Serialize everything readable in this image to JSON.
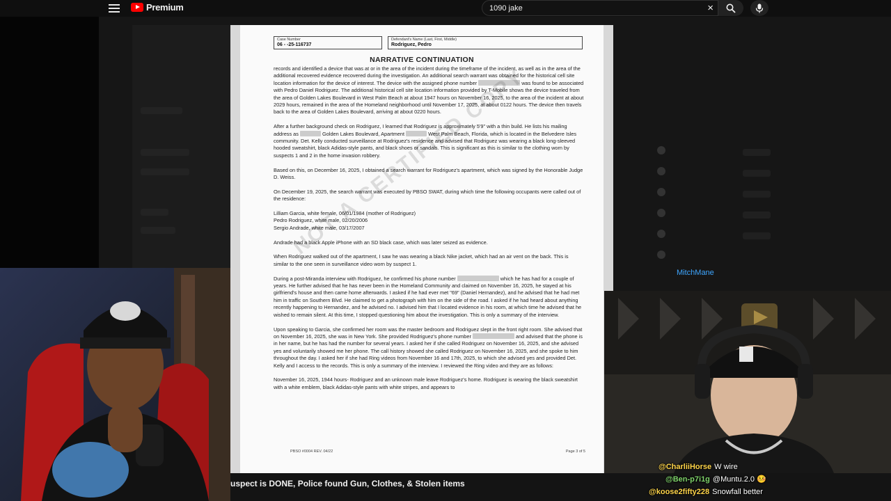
{
  "topbar": {
    "brand": "Premium",
    "search_value": "1090 jake",
    "clear_glyph": "×"
  },
  "document": {
    "case_number_label": "Case Number",
    "case_number": "06 - -25-116737",
    "defendant_label": "Defendant's Name (Last, First, Middle)",
    "defendant_name": "Rodriguez, Pedro",
    "title": "NARRATIVE CONTINUATION",
    "p1a": "records and identified a device that was at or in the area of the incident during the timeframe of the incident, as well as in the area of the additional recovered evidence recovered during the investigation. An additional search warrant was obtained for the historical cell site location information for the device of interest. The device with the assigned phone number",
    "p1b": "was found to be associated with Pedro Daniel Rodriguez. The additional historical cell site location information provided by T-Mobile shows the device traveled from the area of Golden Lakes Boulevard in West Palm Beach at about 1947 hours on November 16, 2025, to the area of the incident at about 2029 hours, remained in the area of the Homeland neighborhood until November 17, 2025, at about 0122 hours. The device then travels back to the area of Golden Lakes Boulevard, arriving at about 0220 hours.",
    "p2a": "After a further background check on Rodriguez, I learned that Rodriguez is approximately 5'9\" with a thin build. He lists his mailing address as",
    "p2b": "Golden Lakes Boulevard, Apartment",
    "p2c": "West Palm Beach, Florida, which is located in the Belvedere Isles community. Det. Kelly conducted surveillance at Rodriguez's residence and advised that Rodriguez was wearing a black long-sleeved hooded sweatshirt, black Adidas-style pants, and black shoes or sandals. This is significant as this is similar to the clothing worn by suspects 1 and 2 in the home invasion robbery.",
    "p3": "Based on this, on December 16, 2025, I obtained a search warrant for Rodriguez's apartment, which was signed by the Honorable Judge D. Weiss.",
    "p4": "On December 19, 2025, the search warrant was executed by PBSO SWAT, during which time the following occupants were called out of the residence:",
    "occ1": "Lilliam Garcia, white female, 06/01/1984 (mother of Rodriguez)",
    "occ2": "Pedro Rodriguez, white male, 02/20/2006",
    "occ3": "Sergio Andrade, white male, 03/17/2007",
    "p5": "Andrade had a black Apple iPhone with an SD black case, which was later seized as evidence.",
    "p6": "When Rodriguez walked out of the apartment, I saw he was wearing a black Nike jacket, which had an air vent on the back. This is similar to the one seen in surveillance video worn by suspect 1.",
    "p7a": "During a post-Miranda interview with Rodriguez, he confirmed his phone number",
    "p7b": "which he has had for a couple of years. He further advised that he has never been in the Homeland Community and claimed on November 16, 2025, he stayed at his girlfriend's house and then came home afterwards. I asked if he had ever met \"69\" (Daniel Hernandez), and he advised that he had met him in traffic on Southern Blvd. He claimed to get a photograph with him on the side of the road. I asked if he had heard about anything recently happening to Hernandez, and he advised no. I advised him that I located evidence in his room, at which time he advised that he wished to remain silent. At this time, I stopped questioning him about the investigation. This is only a summary of the interview.",
    "p8a": "Upon speaking to Garcia, she confirmed her room was the master bedroom and Rodriguez slept in the front right room. She advised that on November 16, 2025, she was in New York. She provided Rodriguez's phone number",
    "p8b": "and advised that the phone is in her name, but he has had the number for several years. I asked her if she called Rodriguez on November 16, 2025, and she advised yes and voluntarily showed me her phone. The call history showed she called Rodriguez on November 16, 2025, and she spoke to him throughout the day. I asked her if she had Ring videos from November 16 and 17th, 2025, to which she advised yes and provided Det. Kelly and I access to the records. This is only a summary of the interview. I reviewed the Ring video and they are as follows:",
    "p9": "November 16, 2025, 1944 hours- Rodriguez and an unknown male leave Rodriguez's home. Rodriguez is wearing the black sweatshirt with a white emblem, black Adidas-style pants with white stripes, and appears to",
    "watermark": "NOT A CERTIFIED COPY",
    "footer_left": "PBSO #0004 REV. 04/22",
    "footer_right": "Page 3 of 5"
  },
  "video": {
    "title": "uspect is DONE, Police found Gun, Clothes, & Stolen items"
  },
  "chat": {
    "pinned_user": "MitchMane",
    "messages": [
      {
        "user": "@CharliiHorse",
        "text": "W wire",
        "color": "#ffd54a"
      },
      {
        "user": "@Ben-p7i1g",
        "text": "@Muntu.2.0 🤒",
        "color": "#7fd36b"
      },
      {
        "user": "@koose2fifty228",
        "text": "Snowfall better",
        "color": "#ffd54a"
      }
    ]
  },
  "colors": {
    "yt_red": "#ff0000",
    "background": "#0f0f0f",
    "link_blue": "#3ea6ff"
  },
  "icons": [
    "menu-icon",
    "youtube-logo-icon",
    "close-icon",
    "search-icon",
    "mic-icon"
  ]
}
